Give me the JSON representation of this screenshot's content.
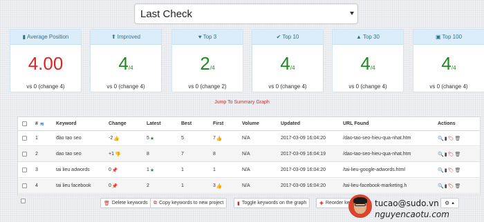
{
  "select": {
    "value": "Last Check"
  },
  "cards": [
    {
      "icon": "bar-chart-icon",
      "glyph": "▮",
      "title": "Average Position",
      "value": "4.00",
      "denominator": "",
      "footer": "vs 0 (change 4)",
      "color": "#e02424"
    },
    {
      "icon": "arrow-up-icon",
      "glyph": "⬆",
      "title": "Improved",
      "value": "4",
      "denominator": "/4",
      "footer": "vs 0 (change 4)",
      "color": "#1f8a1f"
    },
    {
      "icon": "heart-icon",
      "glyph": "♥",
      "title": "Top 3",
      "value": "2",
      "denominator": "/4",
      "footer": "vs 0 (change 2)",
      "color": "#1f8a1f"
    },
    {
      "icon": "check-icon",
      "glyph": "✔",
      "title": "Top 10",
      "value": "4",
      "denominator": "/4",
      "footer": "vs 0 (change 4)",
      "color": "#1f8a1f"
    },
    {
      "icon": "road-icon",
      "glyph": "▲",
      "title": "Top 30",
      "value": "4",
      "denominator": "/4",
      "footer": "vs 0 (change 4)",
      "color": "#1f8a1f"
    },
    {
      "icon": "briefcase-icon",
      "glyph": "▣",
      "title": "Top 100",
      "value": "4",
      "denominator": "/4",
      "footer": "vs 0 (change 4)",
      "color": "#1f8a1f"
    }
  ],
  "jump_link": "Jump To Summary Graph",
  "table": {
    "headers": {
      "number": "#",
      "keyword": "Keyword",
      "change": "Change",
      "latest": "Latest",
      "best": "Best",
      "first": "First",
      "volume": "Volume",
      "updated": "Updated",
      "url": "URL Found",
      "actions": "Actions"
    },
    "rows": [
      {
        "number": "1",
        "keyword": "đào tạo seo",
        "change": "-2",
        "change_icon": "thumbs-up-icon",
        "latest": "5",
        "latest_icon": "star-icon",
        "best": "5",
        "first": "7",
        "first_icon": "thumbs-up-icon",
        "volume": "N/A",
        "updated": "2017-03-09 16:04:20",
        "url": "/dao-tao-seo-hieu-qua-nhat.htm"
      },
      {
        "number": "2",
        "keyword": "dao tao seo",
        "change": "+1",
        "change_icon": "thumbs-down-icon",
        "latest": "8",
        "latest_icon": "",
        "best": "7",
        "first": "8",
        "first_icon": "",
        "volume": "N/A",
        "updated": "2017-03-09 16:04:19",
        "url": "/dao-tao-seo-hieu-qua-nhat.htm"
      },
      {
        "number": "3",
        "keyword": "tai lieu adwords",
        "change": "0",
        "change_icon": "pin-icon",
        "latest": "1",
        "latest_icon": "star-icon",
        "best": "1",
        "first": "1",
        "first_icon": "",
        "volume": "N/A",
        "updated": "2017-03-09 16:04:20",
        "url": "/tai-lieu-google-adwords.html"
      },
      {
        "number": "4",
        "keyword": "tai lieu facebook",
        "change": "0",
        "change_icon": "pin-icon",
        "latest": "2",
        "latest_icon": "",
        "best": "1",
        "first": "3",
        "first_icon": "thumbs-up-icon",
        "volume": "N/A",
        "updated": "2017-03-09 16:04:20",
        "url": "/tai-lieu-facebook-marketing.h"
      }
    ]
  },
  "buttons": {
    "delete": "Delete keywords",
    "copy": "Copy keywords to new project",
    "toggle": "Toggle keywords on the graph",
    "reorder": "Reorder ke"
  },
  "watermark": {
    "line1": "tucao@sudo.vn",
    "line2": "nguyencaotu.com"
  }
}
